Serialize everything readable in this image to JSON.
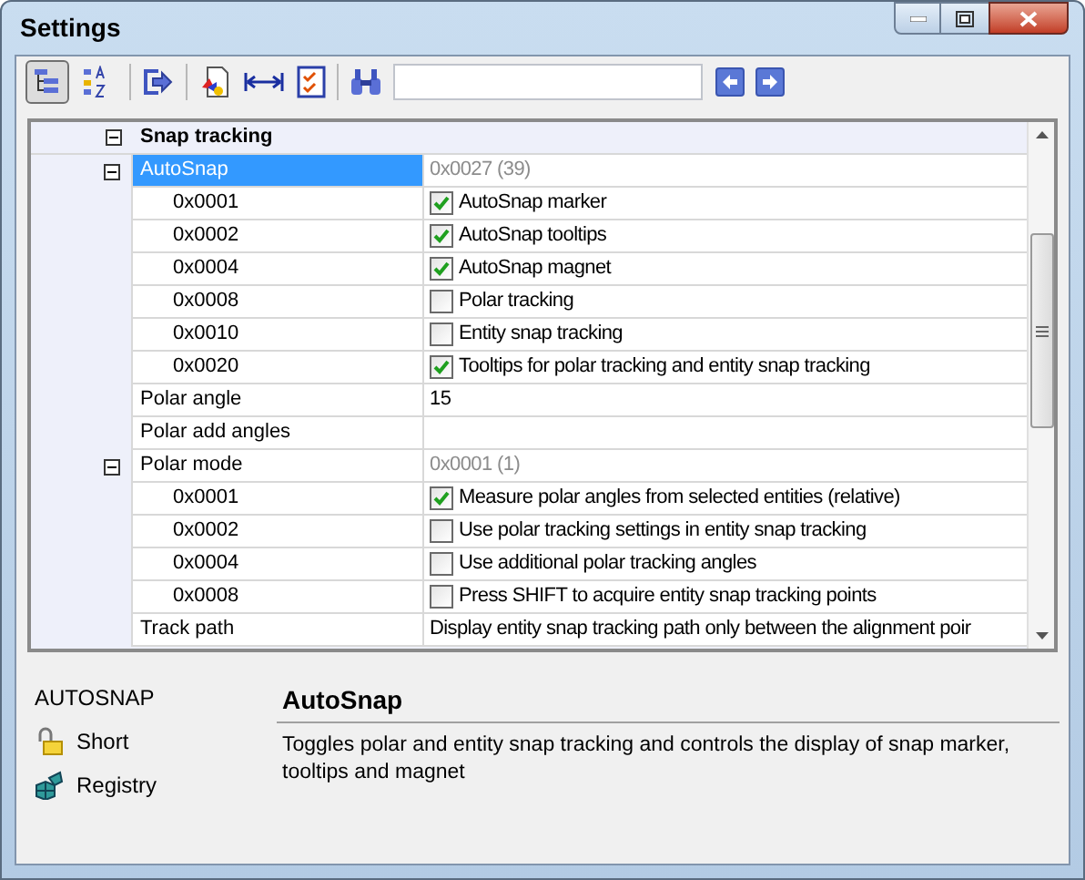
{
  "window": {
    "title": "Settings"
  },
  "toolbar": {
    "view_buttons": [
      {
        "kind": "tree",
        "selected": true
      },
      {
        "kind": "alpha",
        "selected": false
      }
    ]
  },
  "rows": [
    {
      "kind": "category",
      "name": "Snap tracking",
      "expanded": true,
      "selected": false
    },
    {
      "kind": "group",
      "name": "AutoSnap",
      "value": "0x0027 (39)",
      "expanded": true,
      "selected": true
    },
    {
      "kind": "flag",
      "name": "0x0001",
      "value": "AutoSnap marker",
      "checked": true,
      "selected": false
    },
    {
      "kind": "flag",
      "name": "0x0002",
      "value": "AutoSnap tooltips",
      "checked": true,
      "selected": false
    },
    {
      "kind": "flag",
      "name": "0x0004",
      "value": "AutoSnap magnet",
      "checked": true,
      "selected": false
    },
    {
      "kind": "flag",
      "name": "0x0008",
      "value": "Polar tracking",
      "checked": false,
      "selected": false
    },
    {
      "kind": "flag",
      "name": "0x0010",
      "value": "Entity snap tracking",
      "checked": false,
      "selected": false
    },
    {
      "kind": "flag",
      "name": "0x0020",
      "value": "Tooltips for polar tracking and entity snap tracking",
      "checked": true,
      "selected": false
    },
    {
      "kind": "value",
      "name": "Polar angle",
      "value": "15",
      "selected": false
    },
    {
      "kind": "value",
      "name": "Polar add angles",
      "selected": false
    },
    {
      "kind": "group",
      "name": "Polar mode",
      "value": "0x0001 (1)",
      "expanded": true,
      "selected": false
    },
    {
      "kind": "flag",
      "name": "0x0001",
      "value": "Measure polar angles from selected entities (relative)",
      "checked": true,
      "selected": false
    },
    {
      "kind": "flag",
      "name": "0x0002",
      "value": "Use polar tracking settings in entity snap tracking",
      "checked": false,
      "selected": false
    },
    {
      "kind": "flag",
      "name": "0x0004",
      "value": "Use additional polar tracking angles",
      "checked": false,
      "selected": false
    },
    {
      "kind": "flag",
      "name": "0x0008",
      "value": "Press SHIFT to acquire entity snap tracking points",
      "checked": false,
      "selected": false
    },
    {
      "kind": "value",
      "name": "Track path",
      "value": "Display entity snap tracking path only between the alignment poir",
      "selected": false
    }
  ],
  "info": {
    "variable": "AUTOSNAP",
    "short_label": "Short",
    "registry_label": "Registry",
    "title": "AutoSnap",
    "description": "Toggles polar and entity snap tracking and controls the display of snap marker, tooltips and magnet"
  }
}
